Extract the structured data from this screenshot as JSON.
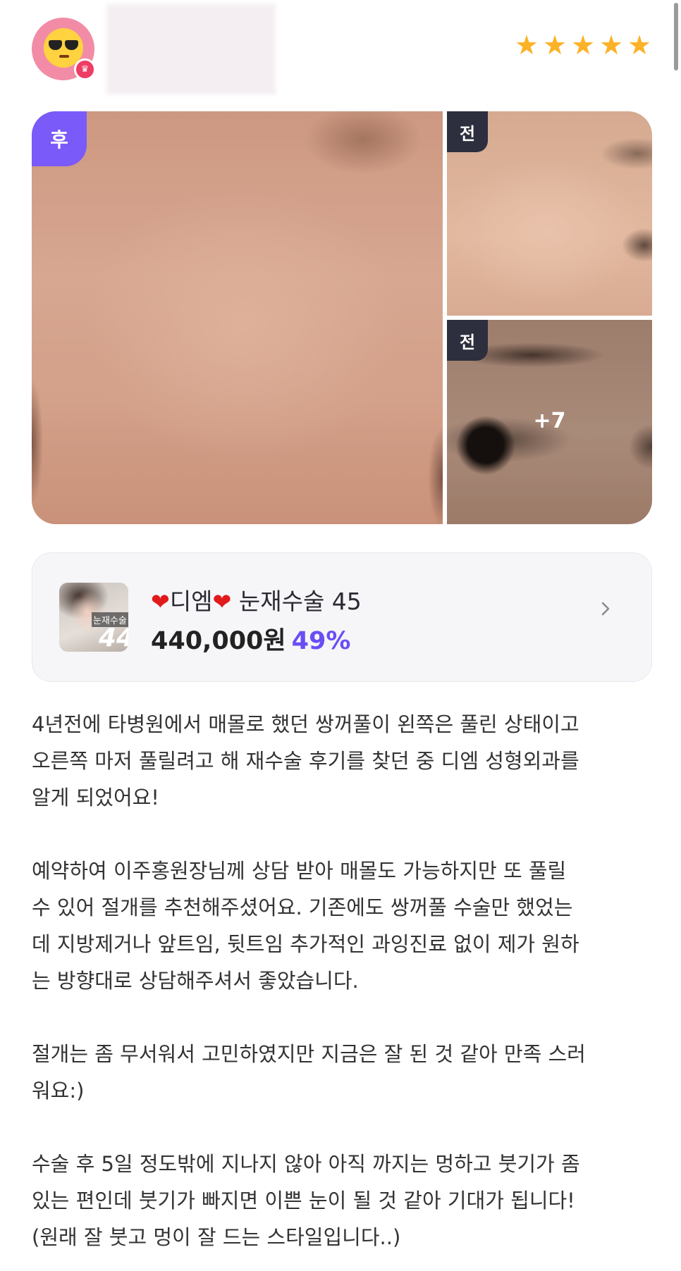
{
  "header": {
    "avatar_icon": "sunglasses-emoji-icon",
    "crown_icon": "crown-icon",
    "rating": 5,
    "rating_max": 5,
    "star_color": "#fbb227"
  },
  "gallery": {
    "main_badge": "후",
    "side_badges": [
      "전",
      "전"
    ],
    "more_count": "+7",
    "after_badge_color": "#7a5af8",
    "before_badge_color": "#2e2f3e"
  },
  "product": {
    "title_hospital": "디엠",
    "title_procedure": "눈재수술 45",
    "price": "440,000원",
    "discount": "49%",
    "thumb_label": "눈재수술",
    "thumb_number": "44",
    "accent_color": "#6a4ef5"
  },
  "review": {
    "paragraphs": [
      "4년전에 타병원에서 매몰로 했던 쌍꺼풀이 왼쪽은 풀린 상태이고\n오른쪽 마저 풀릴려고 해 재수술 후기를 찾던 중 디엠 성형외과를\n알게 되었어요!",
      "예약하여 이주홍원장님께 상담 받아 매몰도 가능하지만 또 풀릴\n수 있어 절개를 추천해주셨어요. 기존에도 쌍꺼풀 수술만 했었는\n데 지방제거나 앞트임, 뒷트임 추가적인 과잉진료 없이 제가 원하\n는 방향대로 상담해주셔서 좋았습니다.",
      "절개는 좀 무서워서 고민하였지만 지금은 잘 된 것 같아 만족 스러\n워요:)",
      "수술 후 5일 정도밖에 지나지 않아 아직 까지는 멍하고 붓기가 좀\n있는 편인데 붓기가 빠지면 이쁜 눈이 될 것 같아 기대가 됩니다!\n(원래 잘 붓고 멍이 잘 드는 스타일입니다..)"
    ]
  }
}
